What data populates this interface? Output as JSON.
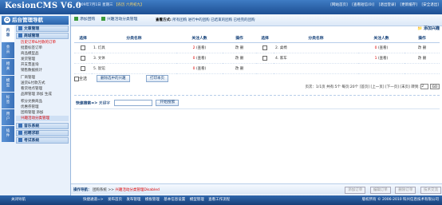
{
  "header": {
    "logo": "KesionCMS V6.0",
    "date": "2009年7月1日 星期三",
    "lunar": "农历 六月初九",
    "links": [
      "[网站首页]",
      "[查看短信(0)]",
      "[退出登录]",
      "[更新缓存]",
      "[安全退出]"
    ]
  },
  "sidebar": {
    "title": "后台管理导航",
    "tabs": [
      "内\n容",
      "会\n员",
      "相\n关",
      "模\n型",
      "标\n签",
      "用\n户",
      "插\n件"
    ],
    "groups": [
      {
        "label": "文章管理",
        "items": []
      },
      {
        "label": "商城管理",
        "items": [
          "历史订单&付款的订单",
          "批量标签订单",
          "商品模型品",
          "发货管理",
          "开支票查询",
          "销售数据统计"
        ]
      },
      {
        "label": "",
        "items": [
          "厂商管理",
          "送货&付款方式",
          "看货地点管理",
          "品牌管理 添加 生成"
        ]
      },
      {
        "label": "",
        "items": [
          "积分兑换商品",
          "优惠券管理",
          "团购管理 添加",
          "兴趣活动分类管理"
        ]
      },
      {
        "label": "音乐系统",
        "items": []
      },
      {
        "label": "招聘求职",
        "items": []
      },
      {
        "label": "考试系统",
        "items": []
      }
    ]
  },
  "toolbar": {
    "add_activity": "添加团购",
    "activity_cat": "兴趣活动分类管理",
    "view_label": "查看方式:",
    "view_options": "所有团购 进行中的团购 已结束的团购 已经完的团购"
  },
  "add_category": "添加兴趣",
  "table": {
    "headers": [
      "选择",
      "分类名称",
      "关注人数",
      "操作",
      "选择",
      "分类名称",
      "关注人数",
      "操作"
    ],
    "rows": [
      {
        "name1": "1. 灯具",
        "count1": "2",
        "view1": "(查看)",
        "ops1": "改 删",
        "name2": "2. 桌椅",
        "count2": "0",
        "view2": "(查看)",
        "ops2": "改 删"
      },
      {
        "name1": "3. 文体",
        "count1": "0",
        "view1": "(查看)",
        "ops1": "改 删",
        "name2": "4. 家车",
        "count2": "1",
        "view2": "(查看)",
        "ops2": "改 删"
      },
      {
        "name1": "5. 饭馆",
        "count1": "0",
        "view1": "(查看)",
        "ops1": "改 删",
        "name2": "",
        "count2": "",
        "view2": "",
        "ops2": ""
      }
    ]
  },
  "actions": {
    "select_all": "全选",
    "delete_selected": "删除选中的兴趣",
    "print": "打印本页"
  },
  "pager": {
    "text": "页次：1/1页 共有:5个 每页:20个 [首页] [上一页] [下一页] [末页] 转到:",
    "page": "2",
    "go": "GO"
  },
  "search": {
    "label": "快速搜索=>",
    "keyword_label": "关键字",
    "button": "开始搜索"
  },
  "status": {
    "prefix": "操作导航：",
    "path": "团购系统 >> ",
    "current": "兴趣活动分类管理Disabled",
    "buttons": [
      "添加订单",
      "编辑订单",
      "删除订单",
      "技术交流"
    ]
  },
  "footer": {
    "exit": "关闭导航",
    "quick_nav": [
      "快捷通道=>",
      "发布首页",
      "发布管理",
      "模板管理",
      "基本信息设置",
      "模型管理",
      "查看工作流程"
    ],
    "copyright": "版权所有 © 2006-2010 科兴信息技术有限公司"
  }
}
